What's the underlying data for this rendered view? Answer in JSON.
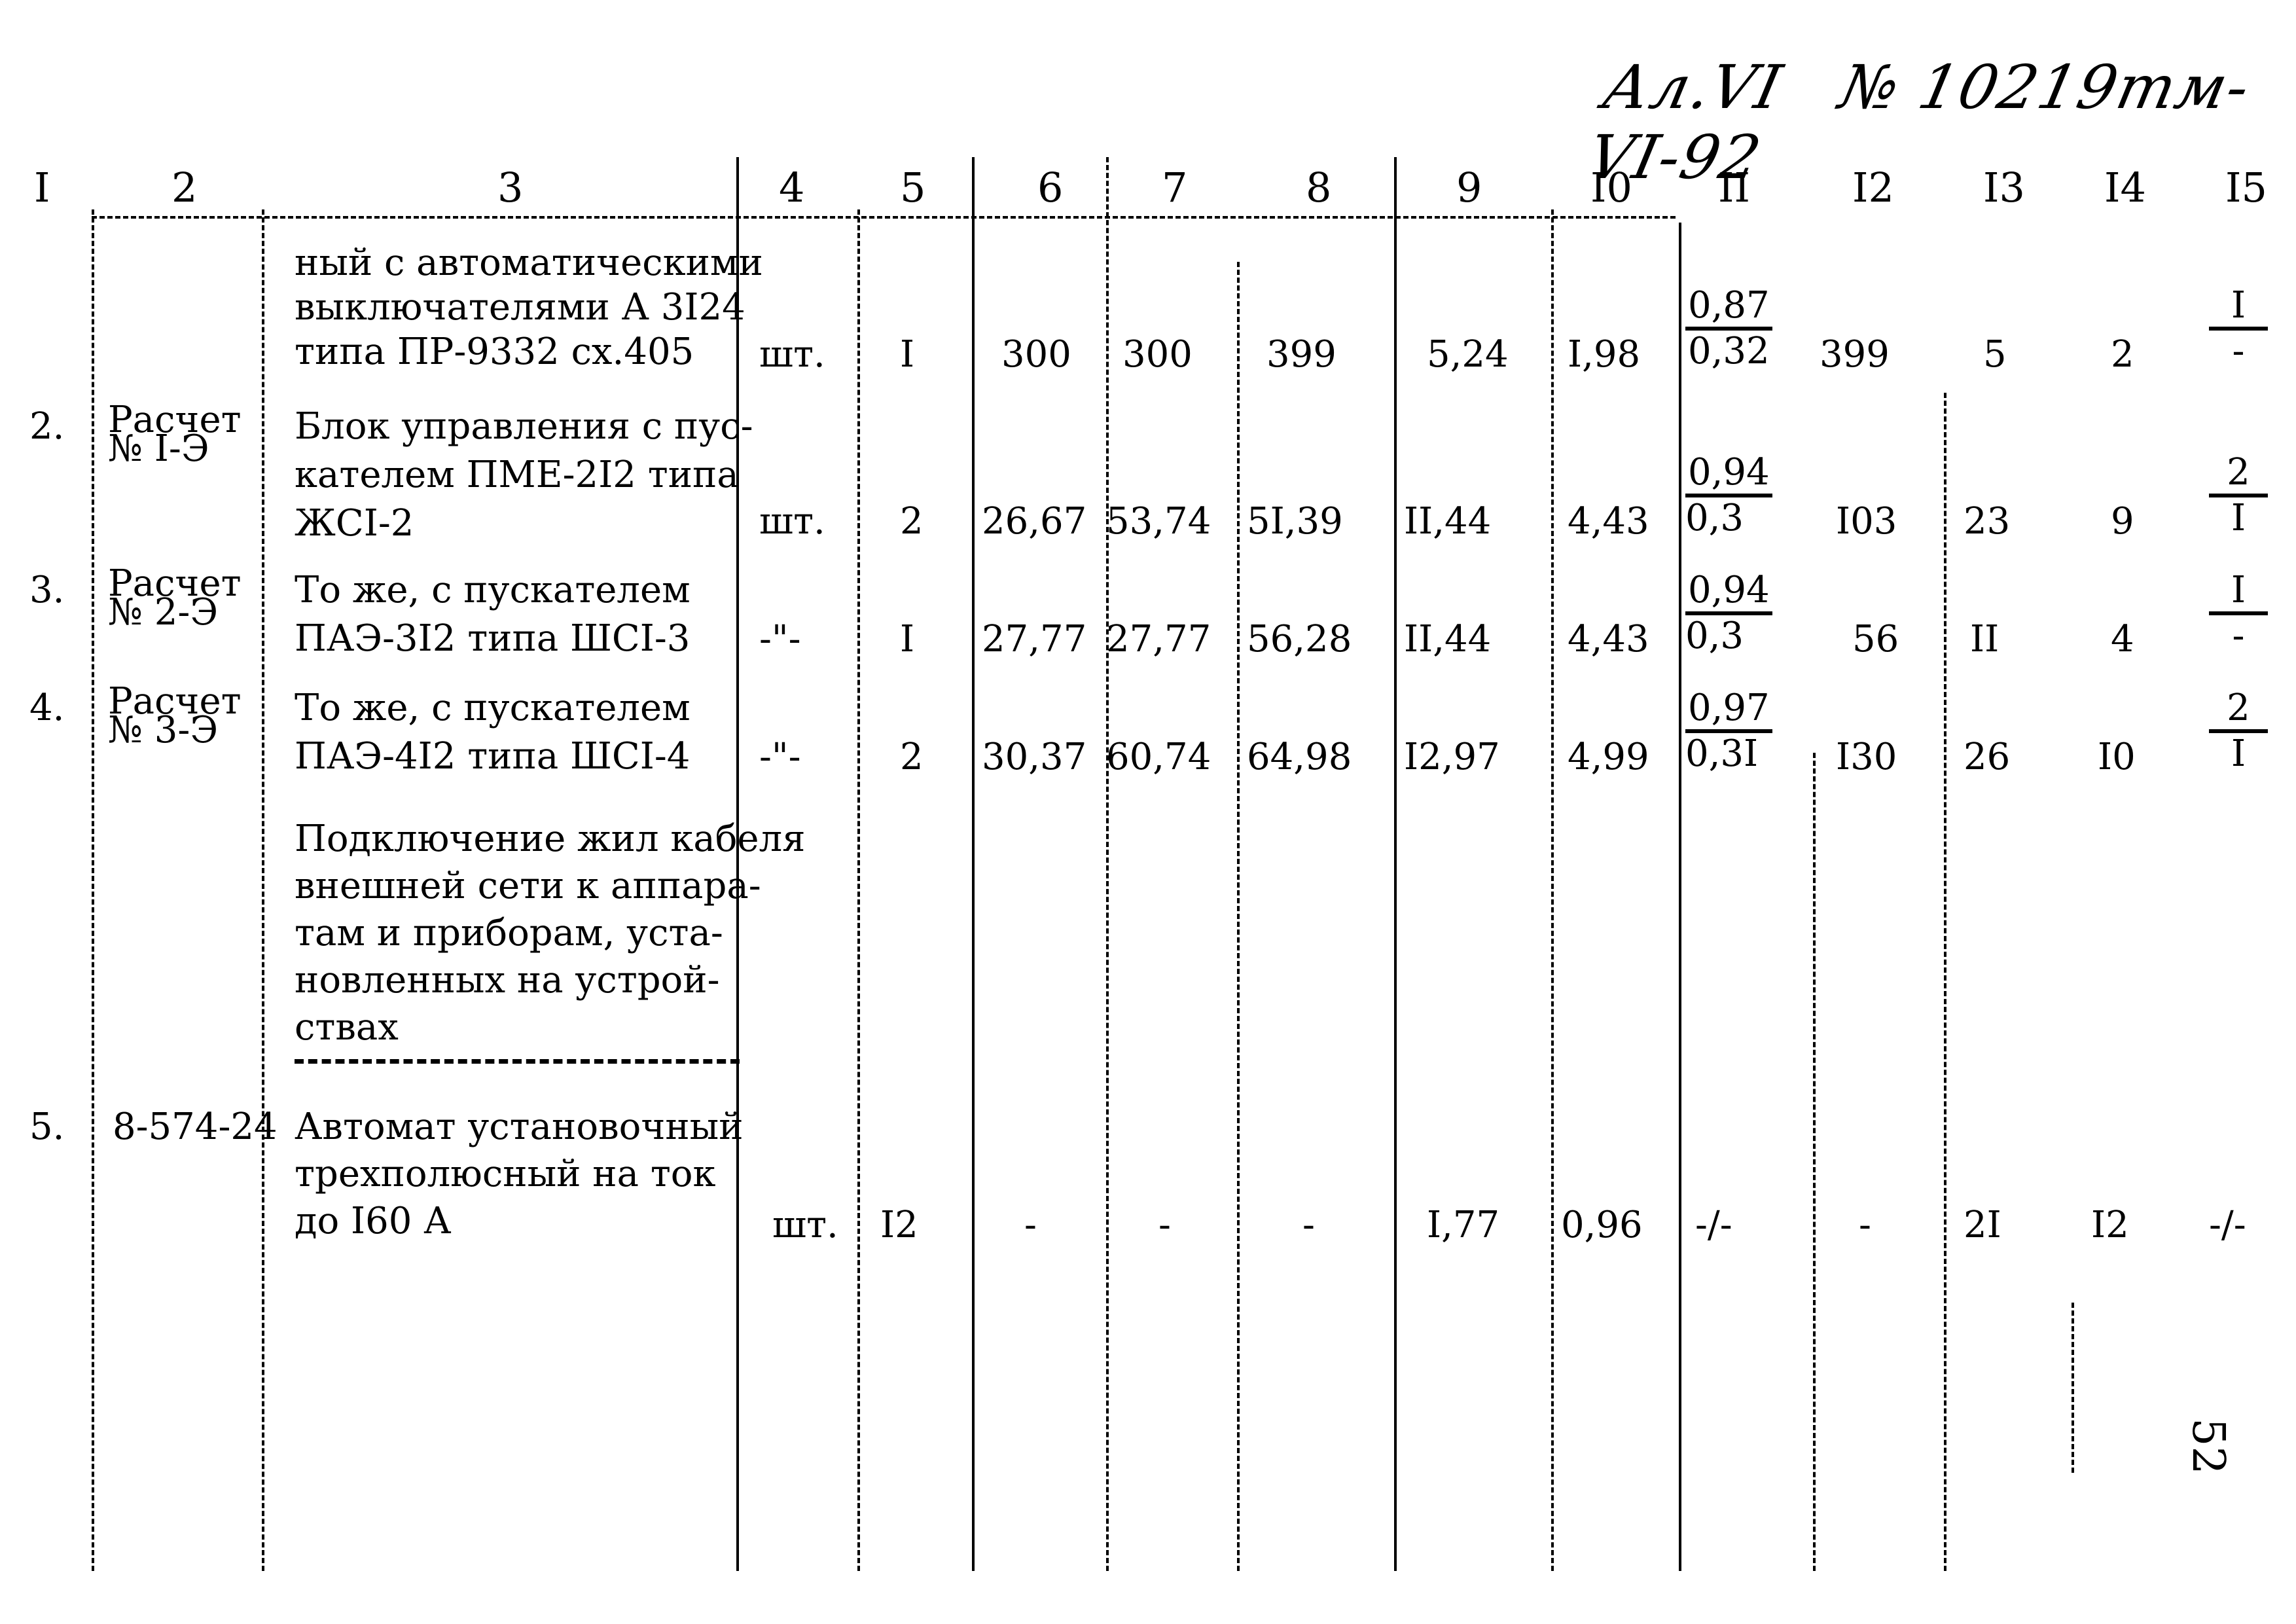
{
  "handwritten_header": {
    "album": "Ал.VI",
    "number": "№ 10219тм-VI-92"
  },
  "column_numbers": [
    "I",
    "2",
    "3",
    "4",
    "5",
    "6",
    "7",
    "8",
    "9",
    "I0",
    "II",
    "I2",
    "I3",
    "I4",
    "I5"
  ],
  "rows": [
    {
      "no": "",
      "ref": "",
      "description": [
        "ный с автоматическими",
        "выключателями А 3I24",
        "типа ПР-9332 сх.405"
      ],
      "unit": "шт.",
      "qty": "I",
      "c6": "300",
      "c7": "300",
      "c8": "399",
      "c9": "5,24",
      "c10": "I,98",
      "c11_num": "0,87",
      "c11_den": "0,32",
      "c12": "399",
      "c13": "5",
      "c14": "2",
      "c15_num": "I",
      "c15_den": "-"
    },
    {
      "no": "2.",
      "ref": [
        "Расчет",
        "№ I-Э"
      ],
      "description": [
        "Блок управления с пус-",
        "кателем ПМЕ-2I2 типа",
        "ЖСI-2"
      ],
      "unit": "шт.",
      "qty": "2",
      "c6": "26,67",
      "c7": "53,74",
      "c8": "5I,39",
      "c9": "II,44",
      "c10": "4,43",
      "c11_num": "0,94",
      "c11_den": "0,3",
      "c12": "I03",
      "c13": "23",
      "c14": "9",
      "c15_num": "2",
      "c15_den": "I"
    },
    {
      "no": "3.",
      "ref": [
        "Расчет",
        "№ 2-Э"
      ],
      "description": [
        "То же, с пускателем",
        "ПАЭ-3I2 типа ШСI-3"
      ],
      "unit": "-\"-",
      "qty": "I",
      "c6": "27,77",
      "c7": "27,77",
      "c8": "56,28",
      "c9": "II,44",
      "c10": "4,43",
      "c11_num": "0,94",
      "c11_den": "0,3",
      "c12": "56",
      "c13": "II",
      "c14": "4",
      "c15_num": "I",
      "c15_den": "-"
    },
    {
      "no": "4.",
      "ref": [
        "Расчет",
        "№ 3-Э"
      ],
      "description": [
        "То же, с пускателем",
        "ПАЭ-4I2 типа ШСI-4"
      ],
      "unit": "-\"-",
      "qty": "2",
      "c6": "30,37",
      "c7": "60,74",
      "c8": "64,98",
      "c9": "I2,97",
      "c10": "4,99",
      "c11_num": "0,97",
      "c11_den": "0,3I",
      "c12": "I30",
      "c13": "26",
      "c14": "I0",
      "c15_num": "2",
      "c15_den": "I"
    }
  ],
  "section_heading": [
    "Подключение жил кабеля",
    "внешней сети к аппара-",
    "там и приборам, уста-",
    "новленных на устрой-",
    "ствах"
  ],
  "row5": {
    "no": "5.",
    "ref": "8-574-24",
    "description": [
      "Автомат установочный",
      "трехполюсный на ток",
      "до I60 А"
    ],
    "unit": "шт.",
    "qty": "I2",
    "c6": "-",
    "c7": "-",
    "c8": "-",
    "c9": "I,77",
    "c10": "0,96",
    "c11": "-/-",
    "c12": "-",
    "c13": "2I",
    "c14": "I2",
    "c15": "-/-"
  },
  "page_number": "52"
}
